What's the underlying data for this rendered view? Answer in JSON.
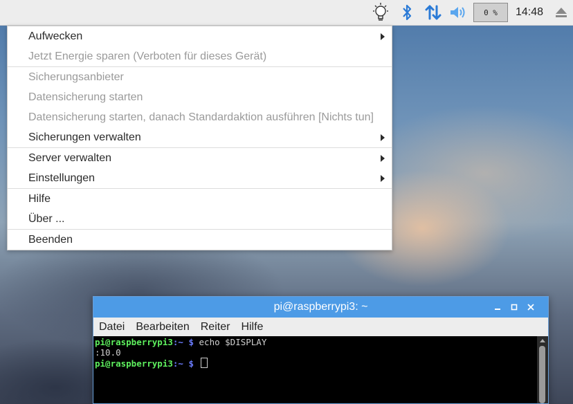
{
  "panel": {
    "cpu_label": "0 %",
    "clock": "14:48",
    "icons": [
      "lightbulb-icon",
      "bluetooth-icon",
      "network-arrows-icon",
      "volume-icon",
      "cpu-monitor",
      "eject-icon"
    ]
  },
  "menu": {
    "items": [
      {
        "label": "Aufwecken",
        "disabled": false,
        "submenu": true
      },
      {
        "label": "Jetzt Energie sparen (Verboten für dieses Gerät)",
        "disabled": true,
        "submenu": false
      },
      {
        "label": "Sicherungsanbieter",
        "disabled": true,
        "submenu": false
      },
      {
        "label": "Datensicherung starten",
        "disabled": true,
        "submenu": false
      },
      {
        "label": "Datensicherung starten, danach Standardaktion ausführen [Nichts tun]",
        "disabled": true,
        "submenu": false
      },
      {
        "label": "Sicherungen verwalten",
        "disabled": false,
        "submenu": true
      },
      {
        "label": "Server verwalten",
        "disabled": false,
        "submenu": true
      },
      {
        "label": "Einstellungen",
        "disabled": false,
        "submenu": true
      },
      {
        "label": "Hilfe",
        "disabled": false,
        "submenu": false
      },
      {
        "label": "Über ...",
        "disabled": false,
        "submenu": false
      },
      {
        "label": "Beenden",
        "disabled": false,
        "submenu": false
      }
    ]
  },
  "terminal": {
    "title": "pi@raspberrypi3: ~",
    "menu": [
      "Datei",
      "Bearbeiten",
      "Reiter",
      "Hilfe"
    ],
    "prompt_user": "pi@raspberrypi3",
    "prompt_path": ":~ $",
    "command1": " echo $DISPLAY",
    "output1": ":10.0",
    "command2": " "
  },
  "colors": {
    "accent": "#4d9be6",
    "prompt_user": "#5ef05e",
    "prompt_path": "#6b7cff",
    "tray_icons": "#2a7ad6"
  }
}
